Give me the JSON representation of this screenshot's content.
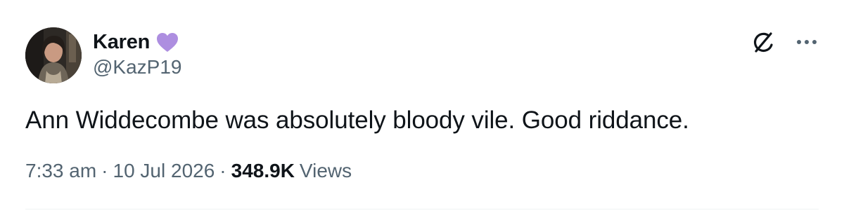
{
  "author": {
    "display_name": "Karen",
    "handle": "@KazP19",
    "badge_icon": "purple-heart-icon",
    "badge_color": "#ad8ee0"
  },
  "tweet": {
    "text": "Ann Widdecombe was absolutely bloody vile. Good riddance."
  },
  "meta": {
    "time": "7:33 am",
    "separator": "·",
    "date": "10 Jul 2026",
    "views_count": "348.9K",
    "views_label": "Views"
  },
  "actions": {
    "grok_icon": "grok-slash-icon",
    "more_icon": "more-dots-icon"
  },
  "colors": {
    "text": "#0f1419",
    "secondary": "#536471",
    "divider": "#eff3f4"
  }
}
